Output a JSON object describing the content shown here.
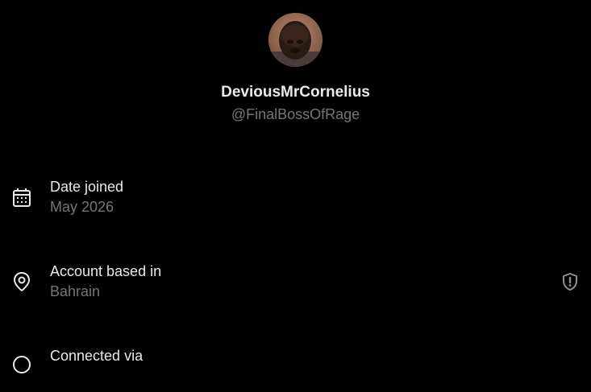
{
  "profile": {
    "display_name": "DeviousMrCornelius",
    "handle": "@FinalBossOfRage"
  },
  "rows": [
    {
      "label": "Date joined",
      "value": "May 2026",
      "icon": "calendar-icon"
    },
    {
      "label": "Account based in",
      "value": "Bahrain",
      "icon": "location-pin-icon",
      "trailing_icon": "shield-alert-icon"
    },
    {
      "label": "Connected via",
      "icon": "link-icon"
    }
  ],
  "colors": {
    "background": "#000000",
    "primary_text": "#e7e9ea",
    "secondary_text": "#71767b"
  }
}
